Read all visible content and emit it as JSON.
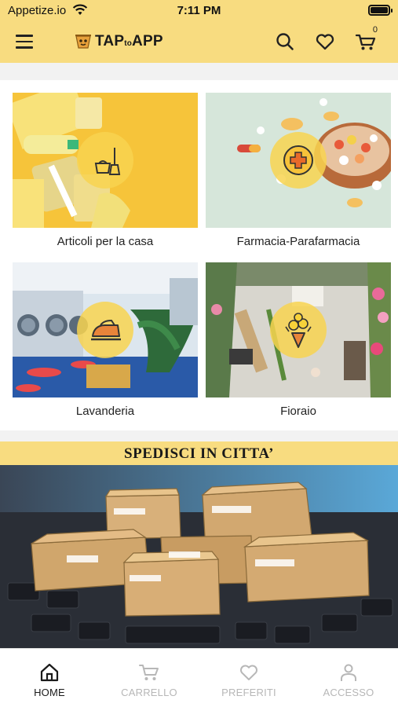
{
  "status_bar": {
    "carrier": "Appetize.io",
    "time": "7:11 PM"
  },
  "header": {
    "logo_main_1": "TAP",
    "logo_small": "to",
    "logo_main_2": "APP",
    "cart_count": "0"
  },
  "categories": [
    {
      "label": "Articoli per la casa",
      "icon": "cleaning-icon"
    },
    {
      "label": "Farmacia-Parafarmacia",
      "icon": "pharmacy-cross-icon"
    },
    {
      "label": "Lavanderia",
      "icon": "iron-icon"
    },
    {
      "label": "Fioraio",
      "icon": "flower-bouquet-icon"
    }
  ],
  "banner": {
    "title": "SPEDISCI IN CITTA’"
  },
  "tabbar": {
    "items": [
      {
        "label": "HOME",
        "icon": "home-icon",
        "active": true
      },
      {
        "label": "CARRELLO",
        "icon": "cart-icon",
        "active": false
      },
      {
        "label": "PREFERITI",
        "icon": "heart-icon",
        "active": false
      },
      {
        "label": "ACCESSO",
        "icon": "user-icon",
        "active": false
      }
    ]
  },
  "colors": {
    "brand_yellow": "#f8dc80",
    "badge_yellow": "#f8d450",
    "tab_inactive": "#b7b7b7",
    "tab_active": "#1a1a1a"
  }
}
